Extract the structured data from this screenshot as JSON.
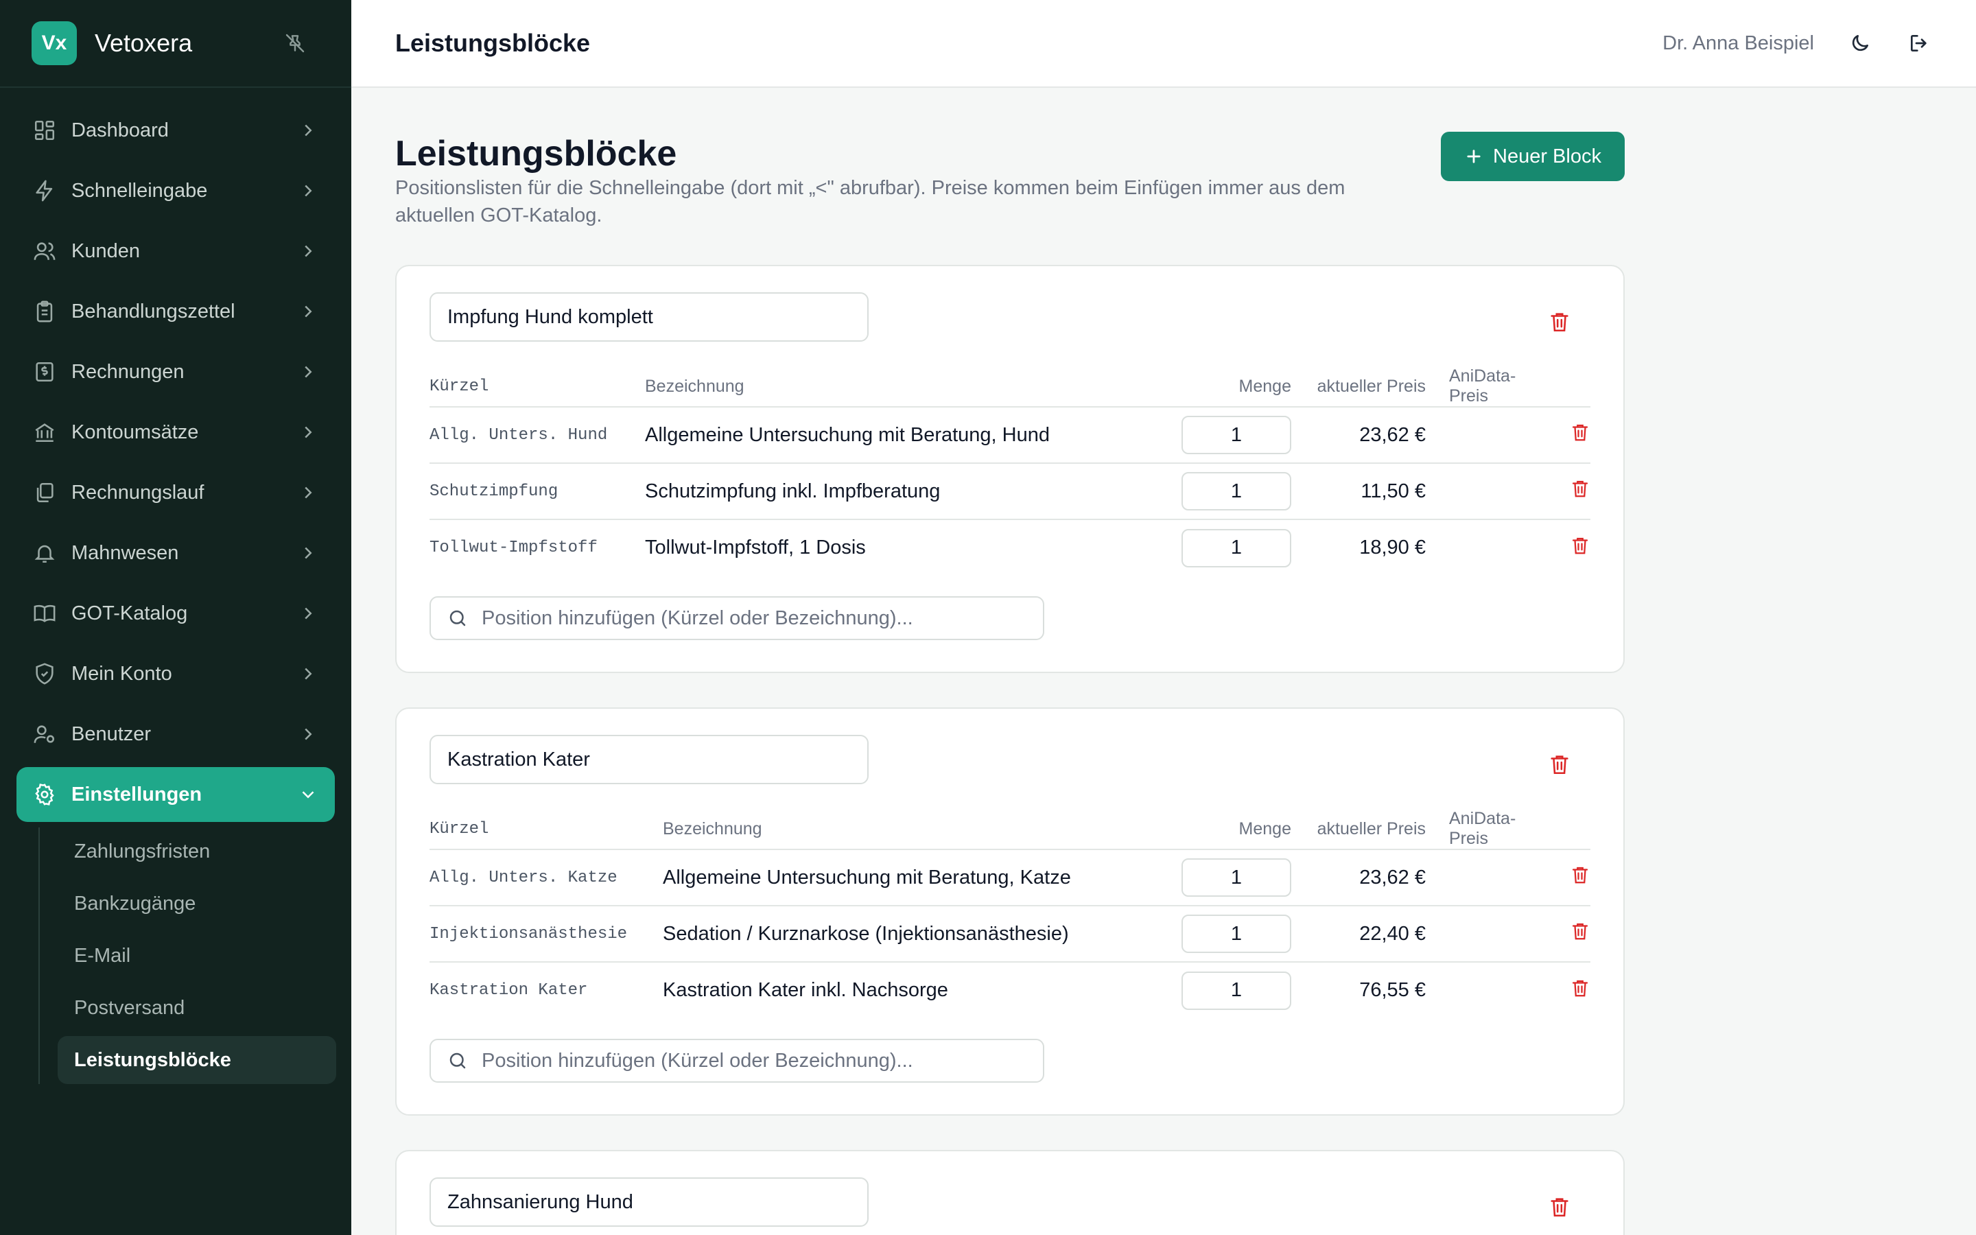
{
  "app": {
    "logo": "Vx",
    "name": "Vetoxera"
  },
  "sidebar": {
    "items": [
      {
        "label": "Dashboard",
        "icon": "dashboard-icon"
      },
      {
        "label": "Schnelleingabe",
        "icon": "bolt-icon"
      },
      {
        "label": "Kunden",
        "icon": "users-icon"
      },
      {
        "label": "Behandlungszettel",
        "icon": "clipboard-icon"
      },
      {
        "label": "Rechnungen",
        "icon": "invoice-icon"
      },
      {
        "label": "Kontoumsätze",
        "icon": "bank-icon"
      },
      {
        "label": "Rechnungslauf",
        "icon": "copies-icon"
      },
      {
        "label": "Mahnwesen",
        "icon": "bell-icon"
      },
      {
        "label": "GOT-Katalog",
        "icon": "book-icon"
      },
      {
        "label": "Mein Konto",
        "icon": "shield-icon"
      },
      {
        "label": "Benutzer",
        "icon": "user-gear-icon"
      },
      {
        "label": "Einstellungen",
        "icon": "gear-icon",
        "active": true
      }
    ],
    "subitems": [
      {
        "label": "Zahlungsfristen"
      },
      {
        "label": "Bankzugänge"
      },
      {
        "label": "E-Mail"
      },
      {
        "label": "Postversand"
      },
      {
        "label": "Leistungsblöcke",
        "active": true
      }
    ]
  },
  "header": {
    "title": "Leistungsblöcke",
    "user": "Dr. Anna Beispiel"
  },
  "page": {
    "title": "Leistungsblöcke",
    "description": "Positionslisten für die Schnelleingabe (dort mit „<\" abrufbar). Preise kommen beim Einfügen immer aus dem aktuellen GOT-Katalog.",
    "new_button": "Neuer Block"
  },
  "table_headers": {
    "code": "Kürzel",
    "name": "Bezeichnung",
    "qty": "Menge",
    "price": "aktueller Preis",
    "anidata": "AniData-Preis"
  },
  "add_placeholder": "Position hinzufügen (Kürzel oder Bezeichnung)...",
  "blocks": [
    {
      "name": "Impfung Hund komplett",
      "rows": [
        {
          "code": "Allg. Unters. Hund",
          "name": "Allgemeine Untersuchung mit Beratung, Hund",
          "qty": "1",
          "price": "23,62 €",
          "anidata": ""
        },
        {
          "code": "Schutzimpfung",
          "name": "Schutzimpfung inkl. Impfberatung",
          "qty": "1",
          "price": "11,50 €",
          "anidata": ""
        },
        {
          "code": "Tollwut-Impfstoff",
          "name": "Tollwut-Impfstoff, 1 Dosis",
          "qty": "1",
          "price": "18,90 €",
          "anidata": ""
        }
      ]
    },
    {
      "name": "Kastration Kater",
      "rows": [
        {
          "code": "Allg. Unters. Katze",
          "name": "Allgemeine Untersuchung mit Beratung, Katze",
          "qty": "1",
          "price": "23,62 €",
          "anidata": ""
        },
        {
          "code": "Injektionsanästhesie",
          "name": "Sedation / Kurznarkose (Injektionsanästhesie)",
          "qty": "1",
          "price": "22,40 €",
          "anidata": ""
        },
        {
          "code": "Kastration Kater",
          "name": "Kastration Kater inkl. Nachsorge",
          "qty": "1",
          "price": "76,55 €",
          "anidata": ""
        }
      ]
    },
    {
      "name": "Zahnsanierung Hund",
      "rows": []
    }
  ],
  "colors": {
    "accent": "#1fa88a",
    "sidebar_bg": "#12231f",
    "danger": "#dc2626",
    "primary_button": "#17896f"
  }
}
